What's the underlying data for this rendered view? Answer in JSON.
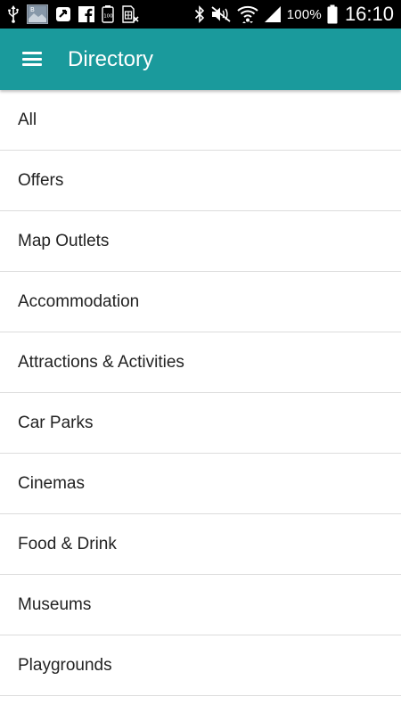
{
  "status_bar": {
    "left_icons": [
      "usb-icon",
      "photo-notification-icon",
      "clip-app-icon",
      "facebook-icon",
      "storage-100-icon",
      "sim-error-icon"
    ],
    "right_icons": [
      "bluetooth-icon",
      "mute-icon",
      "wifi-icon",
      "signal-icon",
      "battery-icon"
    ],
    "battery_percent": "100%",
    "time": "16:10"
  },
  "app_bar": {
    "title": "Directory",
    "color": "#1a9a9c"
  },
  "directory": {
    "items": [
      {
        "label": "All"
      },
      {
        "label": "Offers"
      },
      {
        "label": "Map Outlets"
      },
      {
        "label": "Accommodation"
      },
      {
        "label": "Attractions & Activities"
      },
      {
        "label": "Car Parks"
      },
      {
        "label": "Cinemas"
      },
      {
        "label": "Food & Drink"
      },
      {
        "label": "Museums"
      },
      {
        "label": "Playgrounds"
      }
    ]
  }
}
